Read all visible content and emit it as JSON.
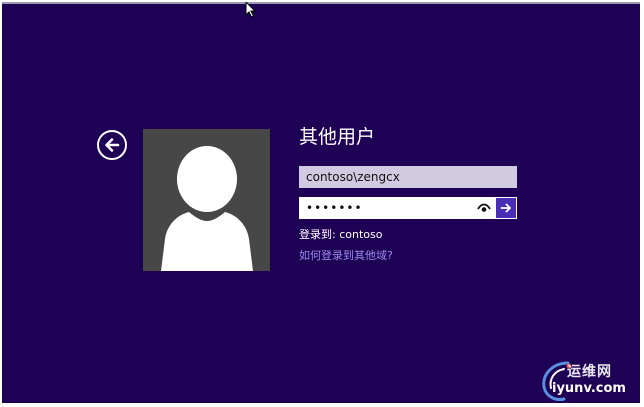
{
  "login": {
    "title": "其他用户",
    "username_value": "contoso\\zengcx",
    "password_value": "•••••••",
    "signin_to": "登录到: contoso",
    "other_domain_link": "如何登录到其他域?"
  },
  "icons": {
    "back": "back-arrow-icon",
    "reveal": "eye-icon",
    "submit": "arrow-right-icon",
    "avatar": "user-silhouette-icon"
  },
  "watermark": {
    "cn": "运维网",
    "en": "iyunv.com"
  },
  "colors": {
    "background": "#1e0054",
    "accent": "#4a2db5",
    "link": "#9b8cf0",
    "avatar_bg": "#474747"
  }
}
